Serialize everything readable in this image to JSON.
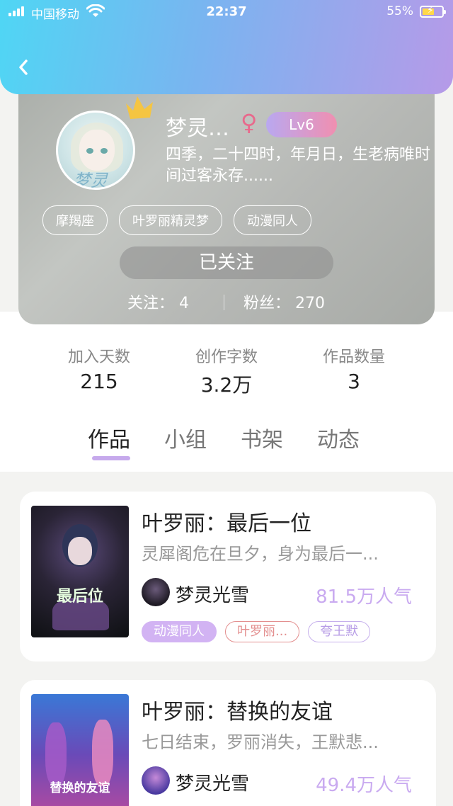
{
  "status_bar": {
    "carrier": "中国移动",
    "time": "22:37",
    "battery": "55%"
  },
  "profile": {
    "name": "梦灵…",
    "gender_symbol": "♀",
    "level": "Lv6",
    "avatar_sign": "梦灵",
    "signature": "四季，二十四时，年月日，生老病唯时间过客永存......",
    "tags": [
      "摩羯座",
      "叶罗丽精灵梦",
      "动漫同人"
    ],
    "follow_button": "已关注",
    "following_label": "关注：",
    "following_count": "4",
    "fans_label": "粉丝：",
    "fans_count": "270"
  },
  "stats": [
    {
      "label": "加入天数",
      "value": "215"
    },
    {
      "label": "创作字数",
      "value": "3.2万"
    },
    {
      "label": "作品数量",
      "value": "3"
    }
  ],
  "tabs": [
    "作品",
    "小组",
    "书架",
    "动态"
  ],
  "active_tab": "作品",
  "works": [
    {
      "title": "叶罗丽：最后一位",
      "description": "灵犀阁危在旦夕，身为最后一...",
      "cover_title": "最后位",
      "author": "梦灵光雪",
      "popularity": "81.5万人气",
      "tags": [
        "动漫同人",
        "叶罗丽...",
        "夸王默"
      ]
    },
    {
      "title": "叶罗丽：替换的友谊",
      "description": "七日结束，罗丽消失，王默悲...",
      "cover_title": "替换的友谊",
      "author": "梦灵光雪",
      "popularity": "49.4万人气",
      "tags": []
    }
  ],
  "colors": {
    "accent_purple": "#c6a9ec",
    "gradient_start": "#4fd6f4",
    "gradient_end": "#b69ae8",
    "level_badge": "#e98fb4"
  }
}
